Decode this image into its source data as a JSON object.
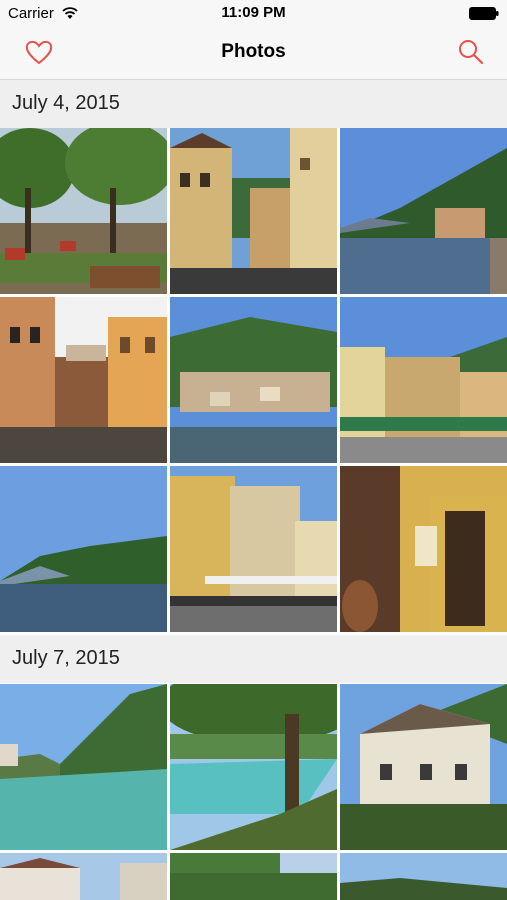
{
  "status_bar": {
    "carrier": "Carrier",
    "time": "11:09 PM"
  },
  "nav": {
    "title": "Photos",
    "left_icon": "heart-icon",
    "right_icon": "search-icon",
    "accent": "#e8524a"
  },
  "sections": [
    {
      "date": "July 4, 2015"
    },
    {
      "date": "July 7, 2015"
    }
  ]
}
